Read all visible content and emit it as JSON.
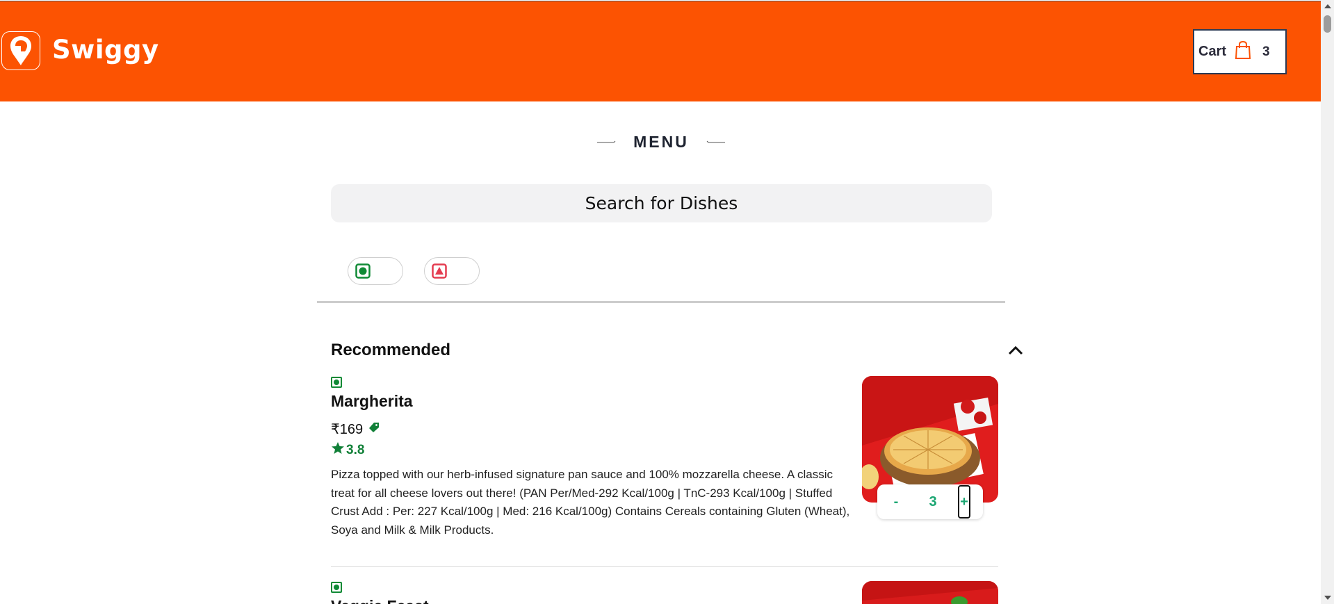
{
  "header": {
    "logo_text": "Swiggy",
    "cart_label": "Cart",
    "cart_count": "3",
    "brand_color": "#fc5302"
  },
  "menu": {
    "title": "MENU"
  },
  "search": {
    "placeholder": "Search for Dishes"
  },
  "filters": {
    "veg_icon": "veg-indicator-icon",
    "nonveg_icon": "nonveg-indicator-icon"
  },
  "section": {
    "title": "Recommended",
    "collapse_icon": "chevron-up-icon",
    "items": [
      {
        "name": "Margherita",
        "price": "₹169",
        "rating": "3.8",
        "description": "Pizza topped with our herb-infused signature pan sauce and 100% mozzarella cheese. A classic treat for all cheese lovers out there! (PAN Per/Med-292 Kcal/100g | TnC-293 Kcal/100g | Stuffed Crust Add : Per: 227 Kcal/100g | Med: 216 Kcal/100g) Contains Cereals containing Gluten (Wheat), Soya and Milk & Milk Products.",
        "qty_minus": "-",
        "qty_value": "3",
        "qty_plus": "+"
      },
      {
        "name": "Veggie Feast"
      }
    ]
  },
  "colors": {
    "veg_green": "#0f8a35",
    "nonveg_red": "#e43b4f",
    "rating_green": "#118038",
    "qty_green": "#1ba672"
  }
}
